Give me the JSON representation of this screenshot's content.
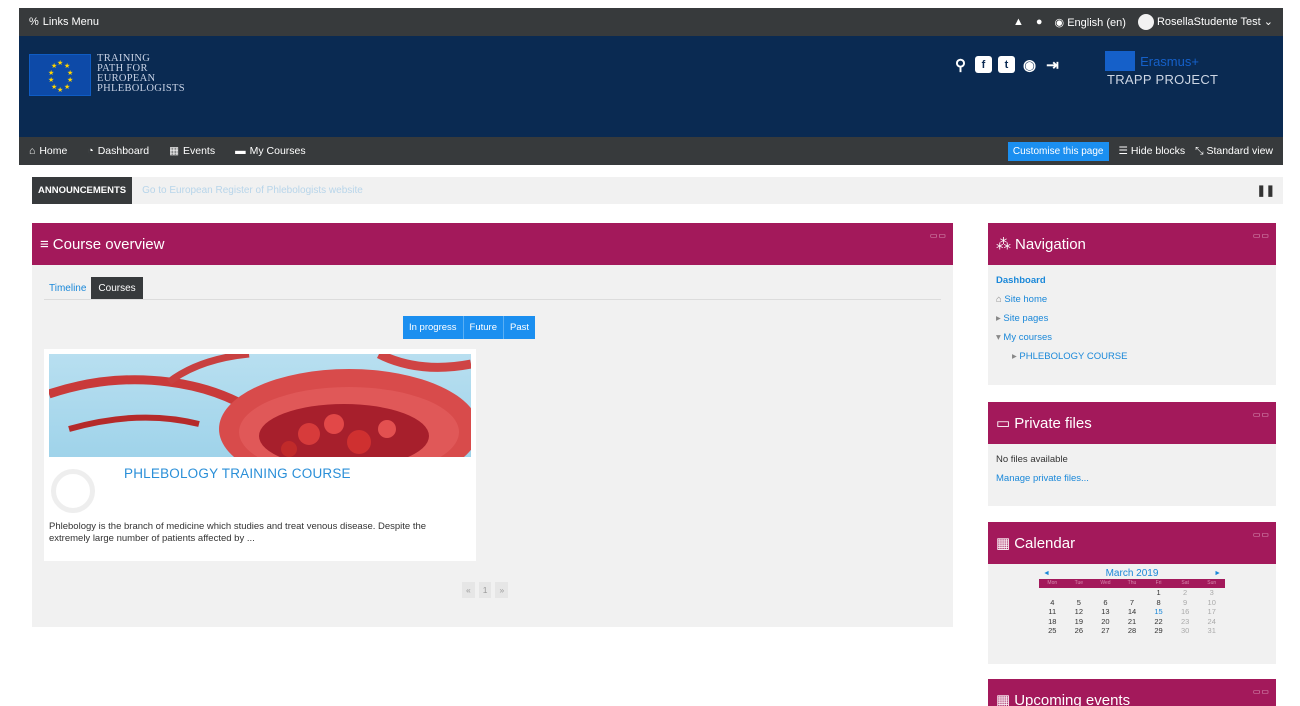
{
  "topbar": {
    "links_menu": "Links Menu",
    "language": "English (en)",
    "user": "RosellaStudente Test"
  },
  "header": {
    "brand_lines": [
      "TRAINING",
      "PATH FOR",
      "EUROPEAN",
      "PHLEBOLOGISTS"
    ],
    "erasmus": "Erasmus+",
    "trapp": "TRAPP PROJECT"
  },
  "nav": {
    "items": [
      "Home",
      "Dashboard",
      "Events",
      "My Courses"
    ],
    "customise": "Customise this page",
    "hide_blocks": "Hide blocks",
    "standard_view": "Standard view"
  },
  "announcements": {
    "label": "ANNOUNCEMENTS",
    "text": "Go to European Register of Phlebologists website"
  },
  "course_overview": {
    "title": "Course overview",
    "tabs": [
      "Timeline",
      "Courses"
    ],
    "filters": [
      "In progress",
      "Future",
      "Past"
    ],
    "course": {
      "title": "PHLEBOLOGY TRAINING COURSE",
      "description": "Phlebology is the branch of medicine which studies and treat venous disease. Despite the extremely large number of patients affected by ..."
    },
    "pager": [
      "«",
      "1",
      "»"
    ]
  },
  "navigation_block": {
    "title": "Navigation",
    "items": [
      "Dashboard",
      "Site home",
      "Site pages",
      "My courses",
      "PHLEBOLOGY COURSE"
    ]
  },
  "private_files": {
    "title": "Private files",
    "empty": "No files available",
    "manage": "Manage private files..."
  },
  "calendar": {
    "title": "Calendar",
    "month": "March 2019",
    "prev": "◄",
    "next": "►",
    "days": [
      "Mon",
      "Tue",
      "Wed",
      "Thu",
      "Fri",
      "Sat",
      "Sun"
    ],
    "weeks": [
      [
        "",
        "",
        "",
        "",
        "1",
        "2",
        "3"
      ],
      [
        "4",
        "5",
        "6",
        "7",
        "8",
        "9",
        "10"
      ],
      [
        "11",
        "12",
        "13",
        "14",
        "15",
        "16",
        "17"
      ],
      [
        "18",
        "19",
        "20",
        "21",
        "22",
        "23",
        "24"
      ],
      [
        "25",
        "26",
        "27",
        "28",
        "29",
        "30",
        "31"
      ]
    ],
    "today": "15"
  },
  "upcoming": {
    "title": "Upcoming events"
  },
  "colors": {
    "accent": "#a3195b",
    "header": "#0a2a52",
    "bar": "#373a3c",
    "link": "#1a88d9"
  }
}
